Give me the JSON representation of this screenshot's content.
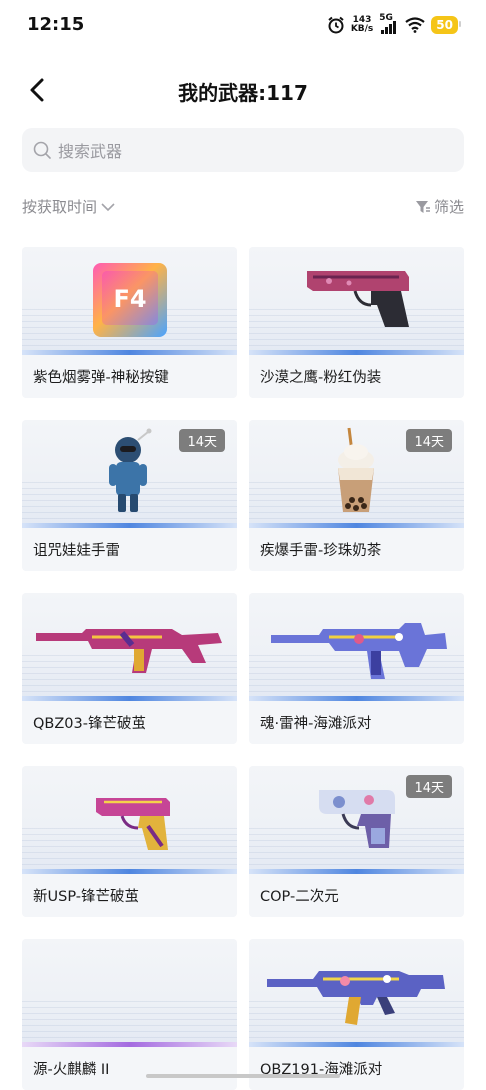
{
  "status_bar": {
    "time": "12:15",
    "net_speed_value": "143",
    "net_speed_unit": "KB/s",
    "network_type": "5G",
    "battery": "50"
  },
  "header": {
    "title": "我的武器:117"
  },
  "search": {
    "placeholder": "搜索武器"
  },
  "toolbar": {
    "sort_label": "按获取时间",
    "filter_label": "筛选"
  },
  "colors": {
    "accent_blue": "#4f86e0",
    "accent_purple": "#a46be0",
    "badge_bg": "#7d7d7d",
    "battery": "#f5c518"
  },
  "items": [
    {
      "name": "紫色烟雾弹-神秘按键",
      "badge": "",
      "icon": "f4-key-icon"
    },
    {
      "name": "沙漠之鹰-粉红伪装",
      "badge": "",
      "icon": "desert-eagle-pistol-icon"
    },
    {
      "name": "诅咒娃娃手雷",
      "badge": "14天",
      "icon": "cursed-doll-grenade-icon"
    },
    {
      "name": "疾爆手雷-珍珠奶茶",
      "badge": "14天",
      "icon": "bubble-tea-grenade-icon"
    },
    {
      "name": "QBZ03-锋芒破茧",
      "badge": "",
      "icon": "rifle-icon"
    },
    {
      "name": "魂·雷神-海滩派对",
      "badge": "",
      "icon": "rifle-icon"
    },
    {
      "name": "新USP-锋芒破茧",
      "badge": "",
      "icon": "pistol-icon"
    },
    {
      "name": "COP-二次元",
      "badge": "14天",
      "icon": "cop-pistol-icon"
    },
    {
      "name": "源-火麒麟 II",
      "badge": "",
      "icon": ""
    },
    {
      "name": "QBZ191-海滩派对",
      "badge": "",
      "icon": "rifle-icon"
    }
  ]
}
